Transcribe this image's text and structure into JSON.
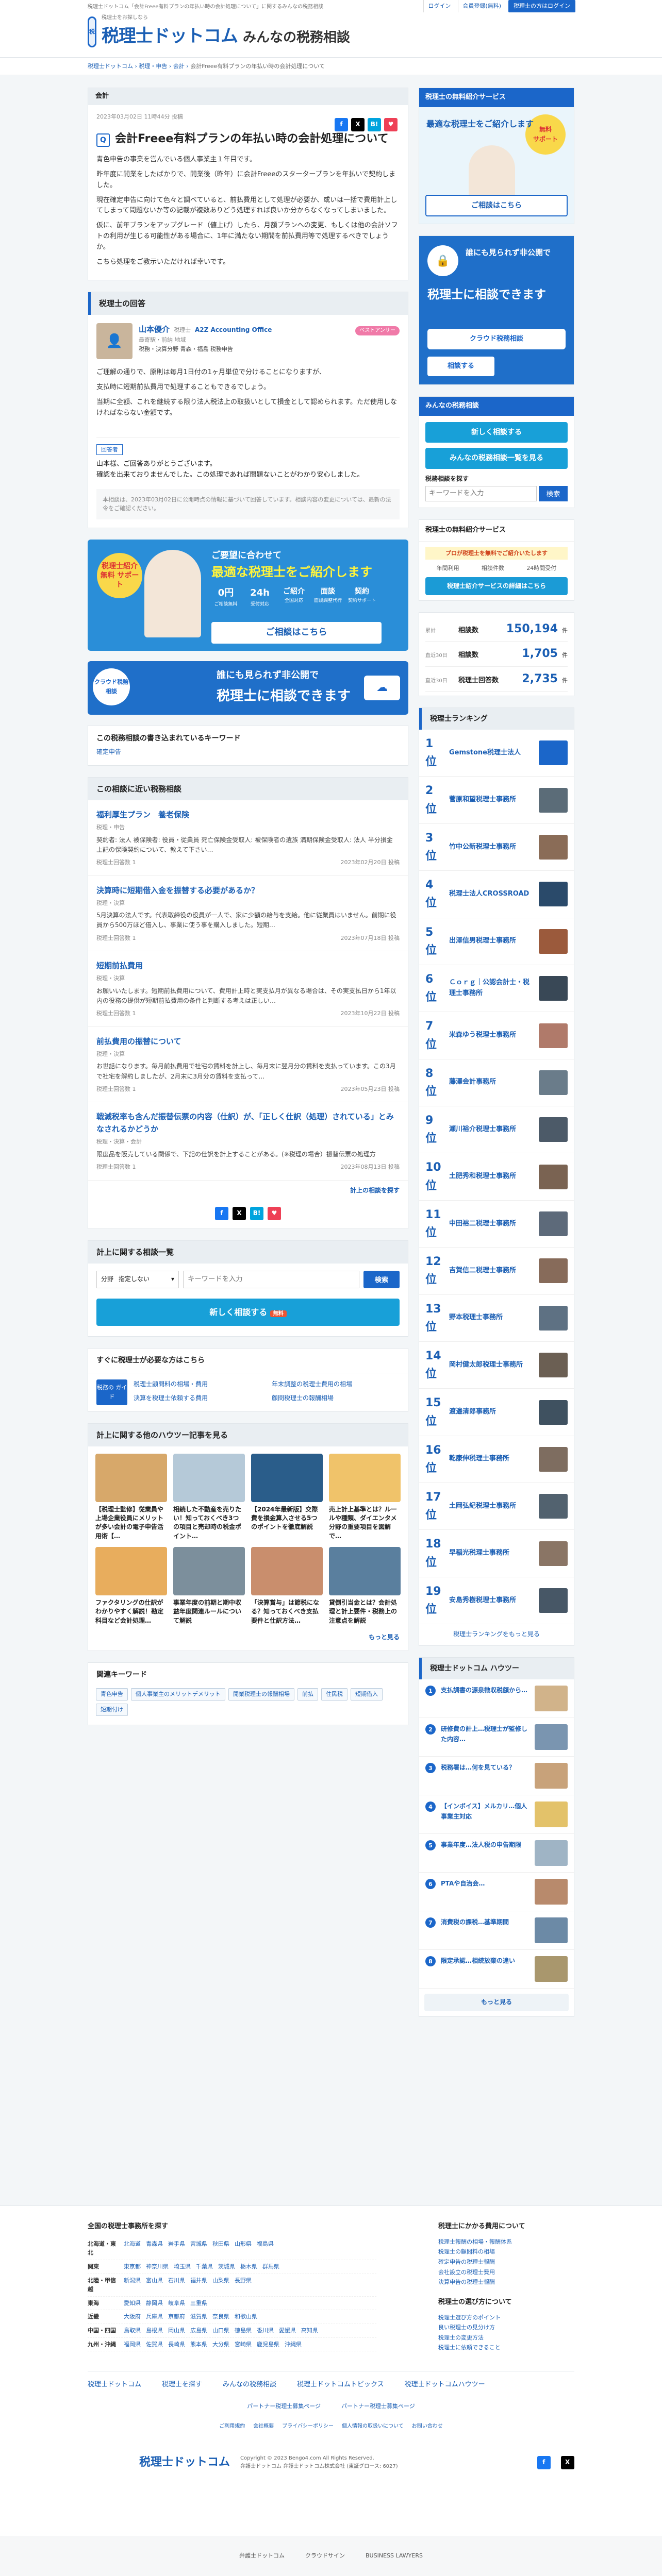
{
  "header": {
    "tagline": "税理士ドットコム「会計Freee有料プランの年払い時の会計処理について」に関するみんなの税務相談",
    "logo_sub": "税理士をお探しなら",
    "logo_main": "税理士ドットコム",
    "logo_sub2": "みんなの税務相談",
    "login": "ログイン",
    "register": "会員登録(無料)",
    "tax_login": "税理士の方はログイン"
  },
  "breadcrumb": [
    "税理士ドットコム",
    "税理・申告",
    "会計",
    "会計Freee有料プランの年払い時の会計処理について"
  ],
  "question": {
    "category": "会計",
    "date": "2023年03月02日 11時44分 投稿",
    "title": "会計Freee有料プランの年払い時の会計処理について",
    "body": [
      "青色申告の事業を営んでいる個人事業主１年目です。",
      "昨年度に開業をしたばかりで、開業後（昨年）に会計Freeeのスターターブランを年払いで契約しました。",
      "現在確定申告に向けて色々と調べていると、前払費用として処理が必要か、或いは一括で費用計上してしまって問題ないか等の記載が複数ありどう処理すれば良いか分からなくなってしまいました。",
      "仮に、前年ブランをアップグレード（値上げ）したら、月額ブランへの変更、もしくは他の会計ソフトの利用が生じる可能性がある場合に、1年に満たない期間を前払費用等で処理するべきでしょうか。",
      "こちら処理をご教示いただければ幸いです。"
    ]
  },
  "answer": {
    "section_title": "税理士の回答",
    "name": "山本優介",
    "name_sub": "税理士",
    "office": "A2Z Accounting Office",
    "pill": "ベストアンサー",
    "tags": "最寄駅・前納 地域",
    "speciality": "税務・決算分野 青森・福島 税務申告",
    "body": [
      "ご理解の通りで、原則は毎月1日付の1ヶ月単位で分けることになりますが、",
      "支払時に短期前払費用で処理することもできるでしょう。",
      "当期に全額、これを継続する限り法人税法上の取扱いとして損金として認められます。ただ使用しなければならない金額です。"
    ],
    "followup_label": "回答者",
    "followup": [
      "山本様、ご回答ありがとうございます。",
      "確認を出来ておりませんでした。この処理であれば問題ないことがわかり安心しました。"
    ],
    "notice": "本相談は、2023年03月02日に公開時点の情報に基づいて回答しています。相談内容の変更については、最新の法令をご確認ください。"
  },
  "banners": {
    "free_support_title": "最適な税理士をご紹介します",
    "free_support_pre": "ご要望に合わせて",
    "free_badge": "税理士紹介 無料 サポート",
    "stat1": "0円",
    "stat1_label": "ご相談無料",
    "stat2": "24h",
    "stat2_label": "受付対応",
    "stat3": "ご紹介",
    "stat3_label": "全国対応",
    "stat4": "面談",
    "stat4_label": "面談調整代行",
    "stat5": "契約",
    "stat5_label": "契約サポート",
    "cta": "ご相談はこちら",
    "cloud_title": "誰にも見られず非公開で",
    "cloud_main": "税理士に相談できます",
    "cloud_badge": "クラウド税務相談",
    "cloud_cta": "相談する"
  },
  "keywords": {
    "title": "この税務相談の書き込まれているキーワード",
    "items": [
      "確定申告"
    ]
  },
  "related": {
    "title": "この相談に近い税務相談",
    "items": [
      {
        "title": "福利厚生プラン　養老保険",
        "cat": "税理・申告",
        "excerpt": "契約者: 法人 被保険者: 役員・従業員 死亡保険金受取人: 被保険者の遺族 満期保険金受取人: 法人 半分損金 上記の保険契約について、教えて下さい…",
        "answers": "税理士回答数 1",
        "date": "2023年02月20日 投稿"
      },
      {
        "title": "決算時に短期借入金を振替する必要があるか？",
        "cat": "税理・決算",
        "excerpt": "5月決算の法人です。代表取締役の役員が一人で、家に少額の給与を支給。他に従業員はいません。前期に役員から500万ほど借入し、事業に使う事を購入しました。短期…",
        "answers": "税理士回答数 1",
        "date": "2023年07月18日 投稿"
      },
      {
        "title": "短期前払費用",
        "cat": "税理・決算",
        "excerpt": "お願いいたします。短期前払費用について、費用計上時と実支払月が異なる場合は、その実支払日から1年以内の役務の提供が短期前払費用の条件と判断する考えは正しい…",
        "answers": "税理士回答数 1",
        "date": "2023年10月22日 投稿"
      },
      {
        "title": "前払費用の振替について",
        "cat": "税理・決算",
        "excerpt": "お世話になります。毎月前払費用で社宅の賃料を計上し、毎月末に翌月分の賃料を支払っています。この3月で社宅を解約しましたが、2月末に3月分の賃料を支払って…",
        "answers": "税理士回答数 1",
        "date": "2023年05月23日 投稿"
      },
      {
        "title": "戦減税率も含んだ振替伝票の内容（仕訳）が、「正しく仕訳（処理）されている」とみなされるかどうか",
        "cat": "税理・決算・会計",
        "excerpt": "限度品を販売している関係で、下記の仕訳を計上することがある。(※税理の場合）振替伝票の処理方",
        "answers": "税理士回答数 1",
        "date": "2023年08月13日 投稿"
      }
    ],
    "more": "計上の相談を探す"
  },
  "search": {
    "title": "計上に関する相談一覧",
    "field_label": "分野",
    "field_value": "指定しない",
    "placeholder": "キーワードを入力",
    "btn": "検索",
    "cta": "新しく相談する",
    "cta_badge": "無料"
  },
  "urgent": {
    "title": "すぐに税理士が必要な方はこちら",
    "label": "税務の ガイド",
    "links": [
      "税理士顧問料の相場・費用",
      "年末調整の税理士費用の相場",
      "決算を税理士依頼する費用",
      "顧問税理士の報酬相場"
    ]
  },
  "howto": {
    "title": "計上に関する他のハウツー記事を見る",
    "items": [
      {
        "t": "【税理士監修】従業員や上場企業役員にメリットが多い会計の電子申告活用術【…",
        "c": "#d7a86a"
      },
      {
        "t": "相続した不動産を売りたい！知っておくべき3つの項目と売却時の税金ポイント…",
        "c": "#b5c9d8"
      },
      {
        "t": "【2024年最新版】交際費を損金算入させる5つのポイントを徹底解説",
        "c": "#2a5d8a"
      },
      {
        "t": "売上計上基準とは？ルールや種類、ダイエンタメ分野の重要項目を図解で…",
        "c": "#f0c36a"
      },
      {
        "t": "ファクタリングの仕訳がわかりやすく解説！勘定科目など会計処理…",
        "c": "#e8ad5d"
      },
      {
        "t": "事業年度の前期と期中収益年度関連ルールについて解説",
        "c": "#7c8f9c"
      },
      {
        "t": "「決算賞与」は節税になる？知っておくべき支払要件と仕訳方法…",
        "c": "#c98e6d"
      },
      {
        "t": "貸倒引当金とは？会計処理と計上要件・税務上の注意点を解説",
        "c": "#5a7f9e"
      }
    ],
    "more": "もっと見る"
  },
  "related_kw": {
    "title": "関連キーワード",
    "items": [
      "青色申告",
      "個人事業主のメリットデメリット",
      "開業税理士の報酬相場",
      "前払",
      "住民税",
      "短期借入",
      "短期付け"
    ]
  },
  "side": {
    "service_title": "税理士の無料紹介サービス",
    "service_cta": "ご相談はこちら",
    "cloud_main": "税理士に相談できます",
    "cloud_cta": "相談する",
    "consult_title": "みんなの税務相談",
    "new_consult": "新しく相談する",
    "list_consult": "みんなの税務相談一覧を見る",
    "search_label": "税務相談を探す",
    "search_ph": "キーワードを入力",
    "search_btn": "検索",
    "intro_title": "税理士の無料紹介サービス",
    "intro_pro": "プロが税理士を無料でご紹介いたします",
    "intro_items": [
      "年間利用",
      "相談件数",
      "24時間受付"
    ],
    "intro_cta": "税理士紹介サービスの詳細はこちら",
    "stats": [
      {
        "l": "累計",
        "k": "相談数",
        "v": "150,194",
        "u": "件"
      },
      {
        "l": "直近30日",
        "k": "相談数",
        "v": "1,705",
        "u": "件"
      },
      {
        "l": "直近30日",
        "k": "税理士回答数",
        "v": "2,735",
        "u": "件"
      }
    ],
    "ranking_title": "税理士ランキング",
    "ranking": [
      {
        "no": "1",
        "nm": "Gemstone税理士法人",
        "c": "#1b66c9"
      },
      {
        "no": "2",
        "nm": "菅原和望税理士事務所",
        "c": "#5b6c78"
      },
      {
        "no": "3",
        "nm": "竹中公新税理士事務所",
        "c": "#8a6c57"
      },
      {
        "no": "4",
        "nm": "税理士法人CROSSROAD",
        "c": "#2a4a6a"
      },
      {
        "no": "5",
        "nm": "出澤信男税理士事務所",
        "c": "#9b5a3c"
      },
      {
        "no": "6",
        "nm": "Ｃｏｒｇ｜公認会計士・税理士事務所",
        "c": "#394856"
      },
      {
        "no": "7",
        "nm": "米森ゆう税理士事務所",
        "c": "#b07a6a"
      },
      {
        "no": "8",
        "nm": "藤澤会計事務所",
        "c": "#6a7c8a"
      },
      {
        "no": "9",
        "nm": "瀬川裕介税理士事務所",
        "c": "#4c5a68"
      },
      {
        "no": "10",
        "nm": "土肥秀和税理士事務所",
        "c": "#7a6352"
      },
      {
        "no": "11",
        "nm": "中田裕二税理士事務所",
        "c": "#5d6a7a"
      },
      {
        "no": "12",
        "nm": "吉賀信二税理士事務所",
        "c": "#876b5a"
      },
      {
        "no": "13",
        "nm": "野本税理士事務所",
        "c": "#5e7183"
      },
      {
        "no": "14",
        "nm": "岡村健太郎税理士事務所",
        "c": "#6b5f53"
      },
      {
        "no": "15",
        "nm": "渡邉清郎事務所",
        "c": "#3f5160"
      },
      {
        "no": "16",
        "nm": "乾康伸税理士事務所",
        "c": "#7e6d60"
      },
      {
        "no": "17",
        "nm": "土岡弘紀税理士事務所",
        "c": "#52626f"
      },
      {
        "no": "18",
        "nm": "早稲光税理士事務所",
        "c": "#8a7565"
      },
      {
        "no": "19",
        "nm": "安島秀樹税理士事務所",
        "c": "#475766"
      }
    ],
    "ranking_more": "税理士ランキングをもっと見る",
    "hw_title": "税理士ドットコム ハウツー",
    "hw": [
      {
        "t": "支払調書の源泉徴収税額から…",
        "c": "#d1b38a"
      },
      {
        "t": "研修費の計上…税理士が監修した内容…",
        "c": "#7a95b0"
      },
      {
        "t": "税務署は…何を見ている？",
        "c": "#c8a27a"
      },
      {
        "t": "【インボイス】メルカリ…個人事業主対応",
        "c": "#e3c26a"
      },
      {
        "t": "事業年度…法人税の申告期限",
        "c": "#9fb4c5"
      },
      {
        "t": "PTAや自治会…",
        "c": "#b88a6c"
      },
      {
        "t": "消費税の課税…基準期間",
        "c": "#6c8aa6"
      },
      {
        "t": "限定承認…相続放棄の違い",
        "c": "#a9976d"
      }
    ],
    "hw_more": "もっと見る"
  },
  "footer": {
    "pref_title": "全国の税理士事務所を探す",
    "prefs": [
      {
        "r": "北海道・東北",
        "p": "北海道 青森県 岩手県 宮城県 秋田県 山形県 福島県"
      },
      {
        "r": "関東",
        "p": "東京都 神奈川県 埼玉県 千葉県 茨城県 栃木県 群馬県"
      },
      {
        "r": "北陸・甲信越",
        "p": "新潟県 富山県 石川県 福井県 山梨県 長野県"
      },
      {
        "r": "東海",
        "p": "愛知県 静岡県 岐阜県 三重県"
      },
      {
        "r": "近畿",
        "p": "大阪府 兵庫県 京都府 滋賀県 奈良県 和歌山県"
      },
      {
        "r": "中国・四国",
        "p": "鳥取県 島根県 岡山県 広島県 山口県 徳島県 香川県 愛媛県 高知県"
      },
      {
        "r": "九州・沖縄",
        "p": "福岡県 佐賀県 長崎県 熊本県 大分県 宮崎県 鹿児島県 沖縄県"
      }
    ],
    "col2_title": "税理士にかかる費用について",
    "col2": [
      "税理士報酬の相場・報酬体系",
      "税理士の顧問料の相場",
      "確定申告の税理士報酬",
      "会社設立の税理士費用",
      "決算申告の税理士報酬"
    ],
    "col3_title": "税理士の選び方について",
    "col3": [
      "税理士選び方のポイント",
      "良い税理士の見分け方",
      "税理士の変更方法",
      "税理士に依頼できること"
    ],
    "nav": [
      "税理士ドットコム",
      "税理士を探す",
      "みんなの税務相談",
      "税理士ドットコムトピックス",
      "税理士ドットコムハウツー"
    ],
    "sub": [
      "パートナー税理士募集ページ",
      "パートナー税理士募集ページ"
    ],
    "policy": [
      "ご利用規約",
      "会社概要",
      "プライバシーポリシー",
      "個人情報の取扱いについて",
      "お問い合わせ"
    ],
    "copy": "Copyright © 2023 Bengo4.com All Rights Reserved.",
    "legal": "弁護士ドットコム 弁護士ドットコム株式会社 (東証グロース: 6027)",
    "bottom": [
      "弁護士ドットコム",
      "クラウドサイン",
      "BUSINESS LAWYERS"
    ]
  }
}
